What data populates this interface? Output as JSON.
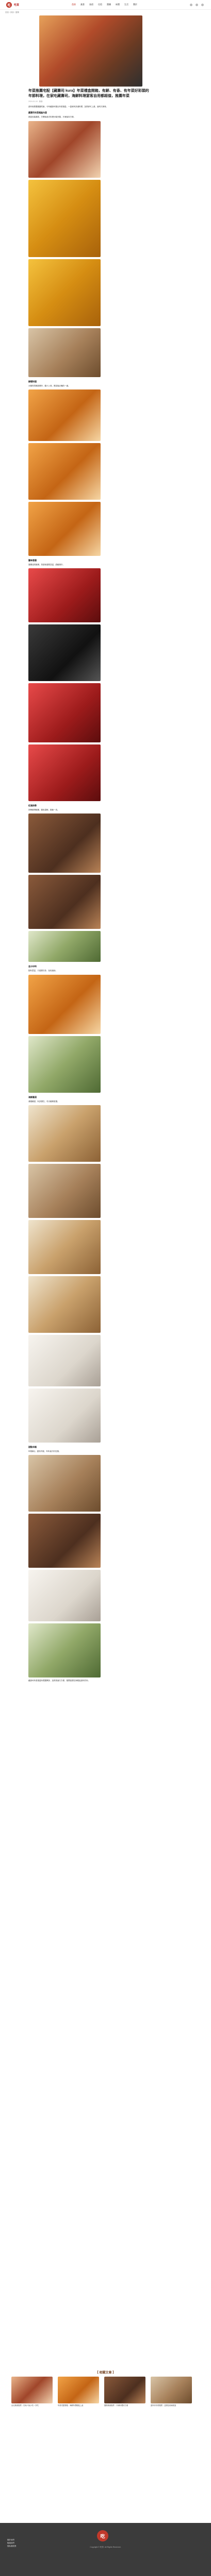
{
  "header": {
    "brand_mark": "吃",
    "brand_name": "吃貨",
    "nav": [
      "首頁",
      "美食",
      "旅遊",
      "住宿",
      "團購",
      "新聞",
      "生活",
      "關於"
    ]
  },
  "breadcrumb": "首頁 / 美食 / 團購",
  "article": {
    "title": "年菜推薦宅配【藏壽司 kura】年菜禮盒開箱，有鮮、有香、有年菜好彩頭的年節料理，在家吃藏壽司，海鮮料理宴客自用都超值，推薦年菜",
    "meta": "2024.01.18 · 美食",
    "intro": "過年就是要團圓吃飯，今年藏壽司推出年菜禮盒，一盒就有多道料理，加熱即可上桌，省時又美味。",
    "sections": [
      {
        "heading": "藏壽司年菜禮盒內容",
        "text": "禮盒包裝喜氣，打開後各式料理分裝完整，冷凍保存方便。"
      },
      {
        "heading": "鮮蝦料理",
        "text": "大蝦肉質鮮甜彈牙，醬汁入味，是宴客必備的一道。"
      },
      {
        "heading": "臘味香腸",
        "text": "香腸油亮飽滿，煎過後香氣四溢，甜鹹適中。"
      },
      {
        "heading": "紅燒排骨",
        "text": "排骨燉得軟嫩，醬色濃郁，配飯一流。"
      },
      {
        "heading": "金沙炒料",
        "text": "配料豐富，口感層次多，色彩繽紛。"
      },
      {
        "heading": "海鮮羹湯",
        "text": "湯頭鮮甜，料多實在，冬天暖胃首選。"
      },
      {
        "heading": "甜點年糕",
        "text": "年糕軟Q，甜而不膩，年年高升好兆頭。"
      }
    ],
    "outro": "藏壽司年菜禮盒料理選擇多，加熱快速又方便，推薦給想在家輕鬆過年的你。"
  },
  "related": {
    "heading": "【 相關文章 】",
    "items": [
      "台北美食推薦｜在地人氣小吃一次吃",
      "年菜宅配開箱｜海鮮料理輕鬆上桌",
      "團購美食推薦｜冷凍料理好方便",
      "過年伴手禮推薦｜送禮自用兩相宜"
    ]
  },
  "footer": {
    "mark": "吃",
    "left": "關於我們\n聯絡我們\n隱私權政策",
    "copyright": "Copyright © 吃貨. All Rights Reserved."
  }
}
